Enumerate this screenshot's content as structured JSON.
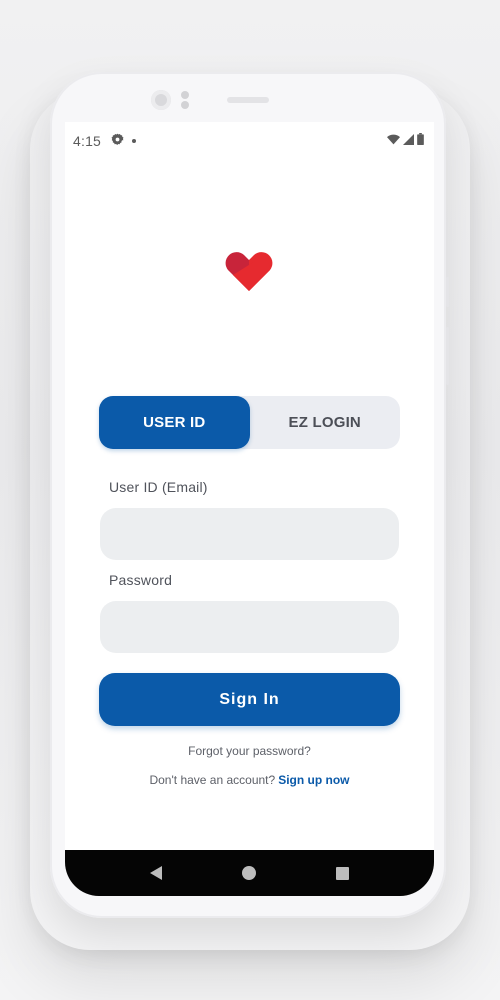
{
  "status_bar": {
    "time": "4:15",
    "icons": [
      "settings-icon",
      "notification-dot-icon",
      "wifi-icon",
      "signal-icon",
      "battery-icon"
    ]
  },
  "logo": {
    "icon": "heart-logo-icon",
    "colors": [
      "#e62a2f",
      "#c8243a"
    ]
  },
  "login_tabs": {
    "user_id_label": "USER ID",
    "ez_login_label": "EZ LOGIN",
    "selected": "USER ID"
  },
  "form": {
    "user_id_label": "User ID (Email)",
    "user_id_value": "",
    "password_label": "Password",
    "password_value": ""
  },
  "sign_in_button": "Sign In",
  "forgot_password": "Forgot your password?",
  "signup": {
    "prompt": "Don't have an account?",
    "link": "Sign up now"
  },
  "nav_bar": {
    "icons": [
      "back-icon",
      "home-icon",
      "recent-apps-icon"
    ]
  },
  "colors": {
    "primary": "#0b5aa9",
    "input_bg": "#eceef0",
    "toggle_bg": "#ebedf2",
    "logo_red": "#e62a2f"
  }
}
